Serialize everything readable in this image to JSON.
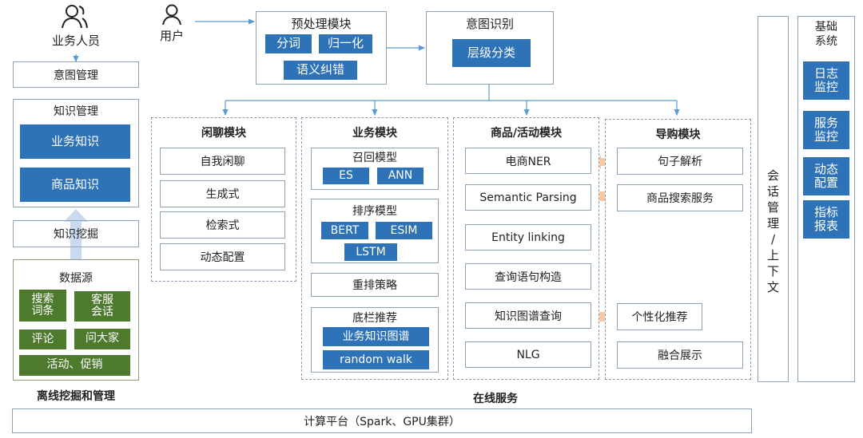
{
  "actors": {
    "business_staff": {
      "label": "业务人员",
      "icon": "users-icon"
    },
    "user": {
      "label": "用户",
      "icon": "user-icon"
    }
  },
  "left": {
    "intent_management": "意图管理",
    "knowledge_management": {
      "title": "知识管理",
      "items": [
        "业务知识",
        "商品知识"
      ]
    },
    "knowledge_mining": "知识挖掘",
    "data_source": {
      "title": "数据源",
      "items": [
        "搜索\n词条",
        "客服\n会话",
        "评论",
        "问大家",
        "活动、促销"
      ]
    },
    "section_label": "离线挖掘和管理"
  },
  "preprocess": {
    "title": "预处理模块",
    "items": [
      "分词",
      "归一化",
      "语义纠错"
    ]
  },
  "intent": {
    "title": "意图识别",
    "items": [
      "层级分类"
    ]
  },
  "chitchat": {
    "title": "闲聊模块",
    "items": [
      "自我闲聊",
      "生成式",
      "检索式",
      "动态配置"
    ]
  },
  "business": {
    "title": "业务模块",
    "recall": {
      "title": "召回模型",
      "items": [
        "ES",
        "ANN"
      ]
    },
    "ranking": {
      "title": "排序模型",
      "items": [
        "BERT",
        "ESIM",
        "LSTM"
      ]
    },
    "rerank": "重排策略",
    "fallback": {
      "title": "底栏推荐",
      "items": [
        "业务知识图谱",
        "random walk"
      ]
    }
  },
  "product": {
    "title": "商品/活动模块",
    "items": [
      "电商NER",
      "Semantic Parsing",
      "Entity linking",
      "查询语句构造",
      "知识图谱查询",
      "NLG"
    ]
  },
  "shopping_guide": {
    "title": "导购模块",
    "items": [
      "句子解析",
      "商品搜索服务",
      "个性化推荐",
      "融合展示"
    ]
  },
  "online_label": "在线服务",
  "session": {
    "chars": [
      "会",
      "话",
      "管",
      "理",
      "/",
      "上",
      "下",
      "文"
    ]
  },
  "base_system": {
    "title": "基础\n系统",
    "items": [
      "日志\n监控",
      "服务\n监控",
      "动态\n配置",
      "指标\n报表"
    ]
  },
  "platform": "计算平台（Spark、GPU集群）",
  "colors": {
    "blue": "#2e73b8",
    "green": "#4e7a2e",
    "border": "#8ea3b8",
    "arrow_blue": "#5b9bd5",
    "arrow_orange": "#f8c8a4",
    "arrow_lightblue": "#c9d9ef"
  }
}
